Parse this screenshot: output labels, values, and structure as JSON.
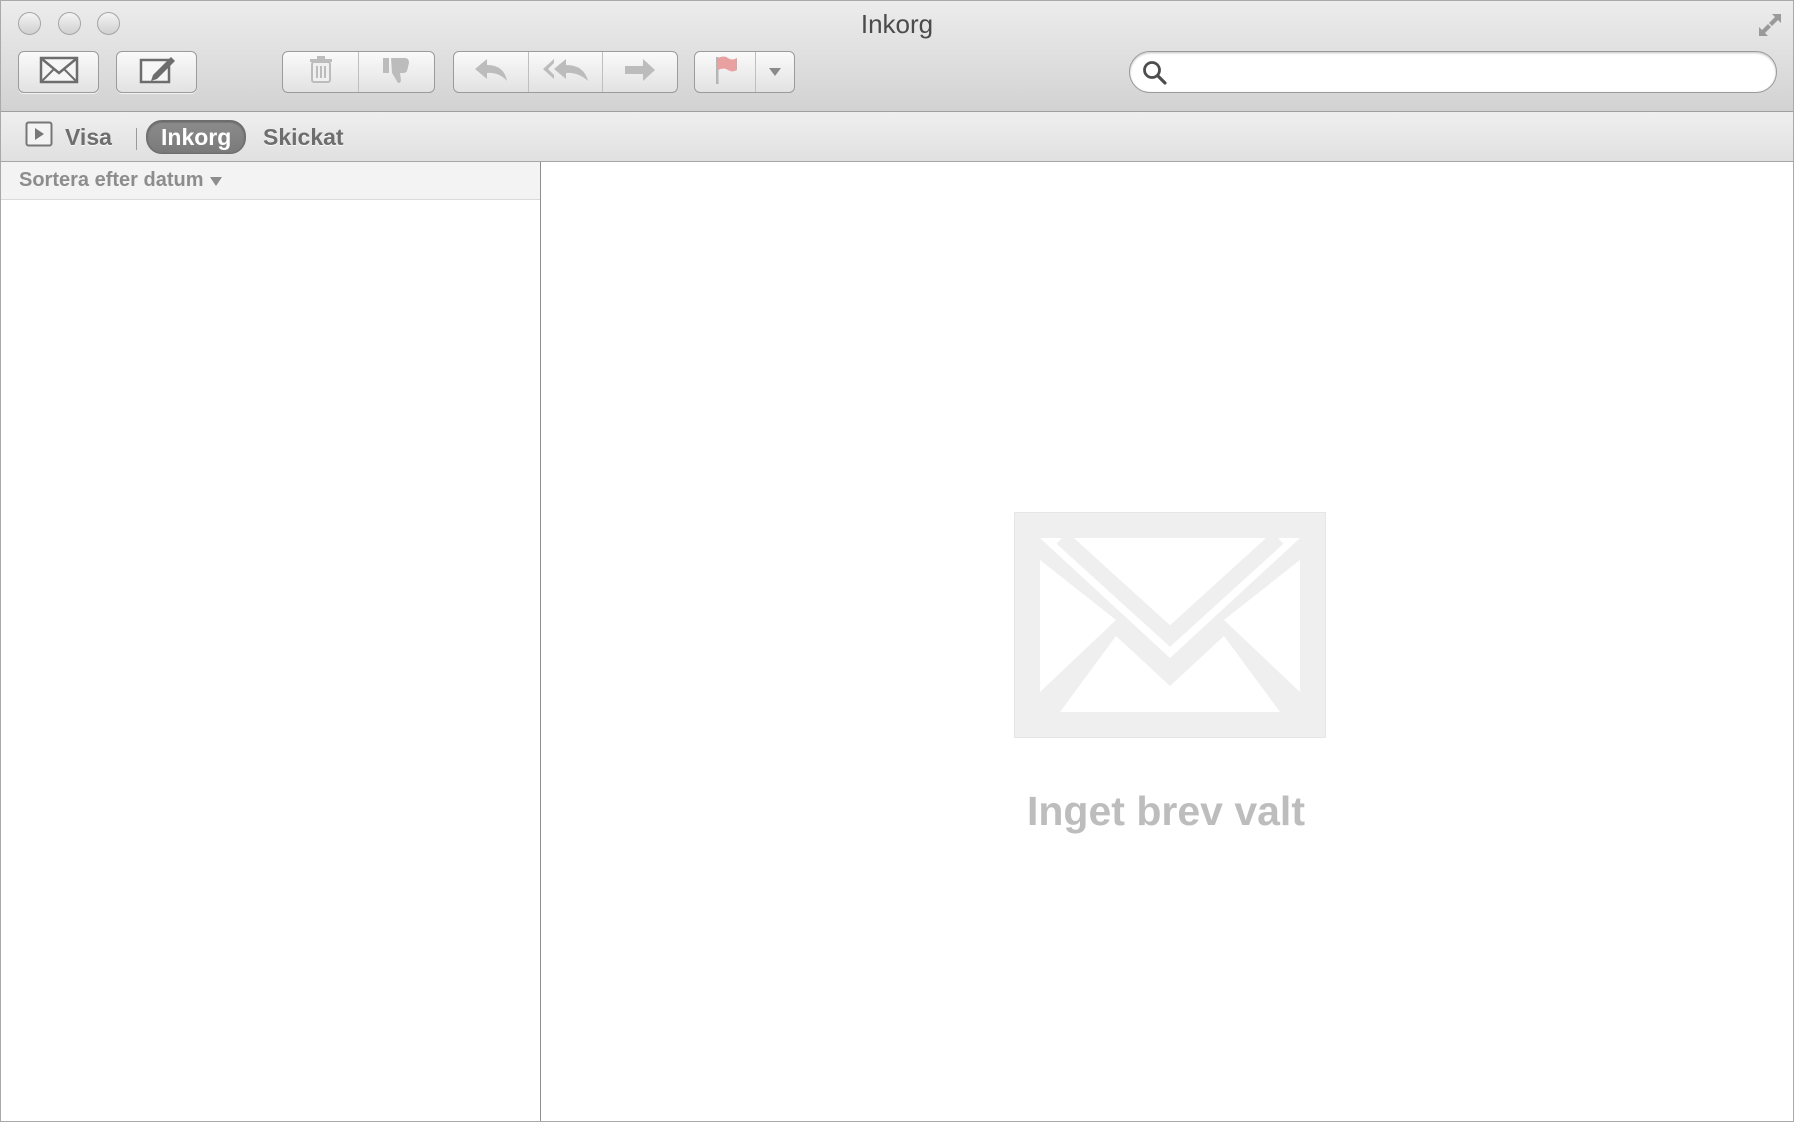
{
  "window": {
    "title": "Inkorg"
  },
  "toolbar": {
    "get_mail_icon": "envelope-icon",
    "compose_icon": "compose-icon",
    "delete_icon": "trash-icon",
    "junk_icon": "thumbs-down-icon",
    "reply_icon": "reply-icon",
    "reply_all_icon": "reply-all-icon",
    "forward_icon": "forward-icon",
    "flag_icon": "flag-icon",
    "flag_color": "#e06a6a",
    "search": {
      "value": "",
      "placeholder": ""
    }
  },
  "favorites": {
    "show_label": "Visa",
    "items": [
      {
        "label": "Inkorg",
        "selected": true
      },
      {
        "label": "Skickat",
        "selected": false
      }
    ]
  },
  "message_list": {
    "sort_label": "Sortera efter datum",
    "messages": []
  },
  "preview": {
    "empty_text": "Inget brev valt",
    "empty_icon": "envelope-icon"
  }
}
